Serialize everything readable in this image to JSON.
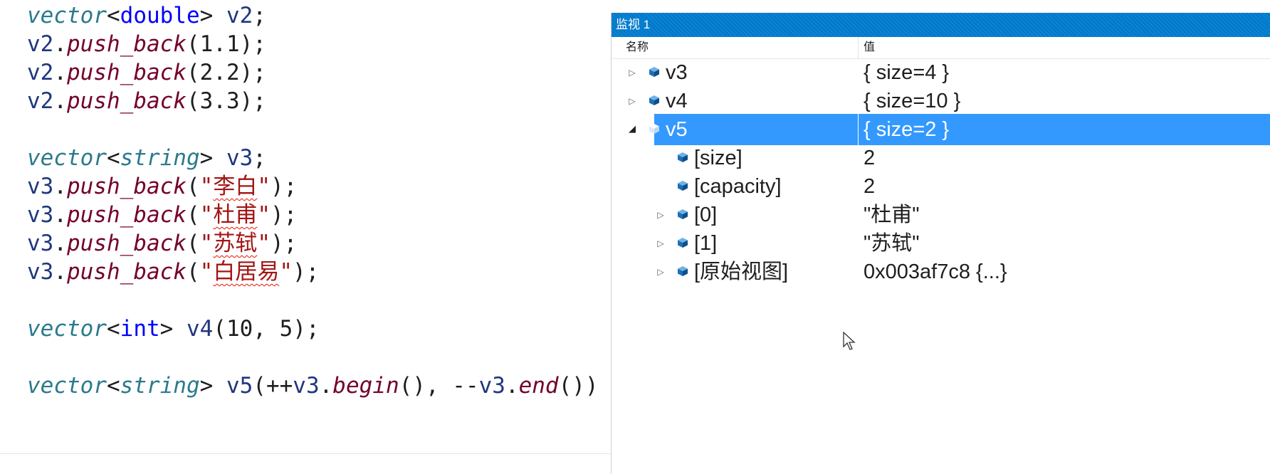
{
  "editor": {
    "lines": [
      [
        {
          "t": "vector",
          "c": "type"
        },
        {
          "t": "<",
          "c": "punct"
        },
        {
          "t": "double",
          "c": "kw"
        },
        {
          "t": "> ",
          "c": "punct"
        },
        {
          "t": "v2",
          "c": "var"
        },
        {
          "t": ";",
          "c": "punct"
        }
      ],
      [
        {
          "t": "v2",
          "c": "var"
        },
        {
          "t": ".",
          "c": "punct"
        },
        {
          "t": "push_back",
          "c": "func"
        },
        {
          "t": "(1.1);",
          "c": "punct"
        }
      ],
      [
        {
          "t": "v2",
          "c": "var"
        },
        {
          "t": ".",
          "c": "punct"
        },
        {
          "t": "push_back",
          "c": "func"
        },
        {
          "t": "(2.2);",
          "c": "punct"
        }
      ],
      [
        {
          "t": "v2",
          "c": "var"
        },
        {
          "t": ".",
          "c": "punct"
        },
        {
          "t": "push_back",
          "c": "func"
        },
        {
          "t": "(3.3);",
          "c": "punct"
        }
      ],
      [],
      [
        {
          "t": "vector",
          "c": "type"
        },
        {
          "t": "<",
          "c": "punct"
        },
        {
          "t": "string",
          "c": "type"
        },
        {
          "t": "> ",
          "c": "punct"
        },
        {
          "t": "v3",
          "c": "var"
        },
        {
          "t": ";",
          "c": "punct"
        }
      ],
      [
        {
          "t": "v3",
          "c": "var"
        },
        {
          "t": ".",
          "c": "punct"
        },
        {
          "t": "push_back",
          "c": "func"
        },
        {
          "t": "(",
          "c": "punct"
        },
        {
          "t": "\"",
          "c": "str"
        },
        {
          "t": "李白",
          "c": "str",
          "sq": true
        },
        {
          "t": "\"",
          "c": "str"
        },
        {
          "t": ");",
          "c": "punct"
        }
      ],
      [
        {
          "t": "v3",
          "c": "var"
        },
        {
          "t": ".",
          "c": "punct"
        },
        {
          "t": "push_back",
          "c": "func"
        },
        {
          "t": "(",
          "c": "punct"
        },
        {
          "t": "\"",
          "c": "str"
        },
        {
          "t": "杜甫",
          "c": "str",
          "sq": true
        },
        {
          "t": "\"",
          "c": "str"
        },
        {
          "t": ");",
          "c": "punct"
        }
      ],
      [
        {
          "t": "v3",
          "c": "var"
        },
        {
          "t": ".",
          "c": "punct"
        },
        {
          "t": "push_back",
          "c": "func"
        },
        {
          "t": "(",
          "c": "punct"
        },
        {
          "t": "\"",
          "c": "str"
        },
        {
          "t": "苏轼",
          "c": "str",
          "sq": true
        },
        {
          "t": "\"",
          "c": "str"
        },
        {
          "t": ");",
          "c": "punct"
        }
      ],
      [
        {
          "t": "v3",
          "c": "var"
        },
        {
          "t": ".",
          "c": "punct"
        },
        {
          "t": "push_back",
          "c": "func"
        },
        {
          "t": "(",
          "c": "punct"
        },
        {
          "t": "\"",
          "c": "str"
        },
        {
          "t": "白居易",
          "c": "str",
          "sq": true
        },
        {
          "t": "\"",
          "c": "str"
        },
        {
          "t": ");",
          "c": "punct"
        }
      ],
      [],
      [
        {
          "t": "vector",
          "c": "type"
        },
        {
          "t": "<",
          "c": "punct"
        },
        {
          "t": "int",
          "c": "kw"
        },
        {
          "t": "> ",
          "c": "punct"
        },
        {
          "t": "v4",
          "c": "var"
        },
        {
          "t": "(10, 5);",
          "c": "punct"
        }
      ],
      [],
      [
        {
          "t": "vector",
          "c": "type"
        },
        {
          "t": "<",
          "c": "punct"
        },
        {
          "t": "string",
          "c": "type"
        },
        {
          "t": "> ",
          "c": "punct"
        },
        {
          "t": "v5",
          "c": "var"
        },
        {
          "t": "(++",
          "c": "punct"
        },
        {
          "t": "v3",
          "c": "var"
        },
        {
          "t": ".",
          "c": "punct"
        },
        {
          "t": "begin",
          "c": "func"
        },
        {
          "t": "(), --",
          "c": "punct"
        },
        {
          "t": "v3",
          "c": "var"
        },
        {
          "t": ".",
          "c": "punct"
        },
        {
          "t": "end",
          "c": "func"
        },
        {
          "t": "())",
          "c": "punct"
        }
      ]
    ]
  },
  "watch": {
    "title": "监视 1",
    "col_name": "名称",
    "col_value": "值",
    "rows": [
      {
        "name": "v3",
        "value": "{ size=4 }",
        "expander": "collapsed",
        "level": 0,
        "selected": false
      },
      {
        "name": "v4",
        "value": "{ size=10 }",
        "expander": "collapsed",
        "level": 0,
        "selected": false
      },
      {
        "name": "v5",
        "value": "{ size=2 }",
        "expander": "expanded",
        "level": 0,
        "selected": true
      },
      {
        "name": "[size]",
        "value": "2",
        "expander": "none",
        "level": 1,
        "selected": false
      },
      {
        "name": "[capacity]",
        "value": "2",
        "expander": "none",
        "level": 1,
        "selected": false
      },
      {
        "name": "[0]",
        "value": "\"杜甫\"",
        "expander": "collapsed",
        "level": 1,
        "selected": false
      },
      {
        "name": "[1]",
        "value": "\"苏轼\"",
        "expander": "collapsed",
        "level": 1,
        "selected": false
      },
      {
        "name": "[原始视图]",
        "value": "0x003af7c8 {...}",
        "expander": "collapsed",
        "level": 1,
        "selected": false
      }
    ]
  },
  "colors": {
    "accent": "#007acc",
    "selection": "#3399ff",
    "string": "#a31515",
    "keyword": "#0000ff"
  }
}
